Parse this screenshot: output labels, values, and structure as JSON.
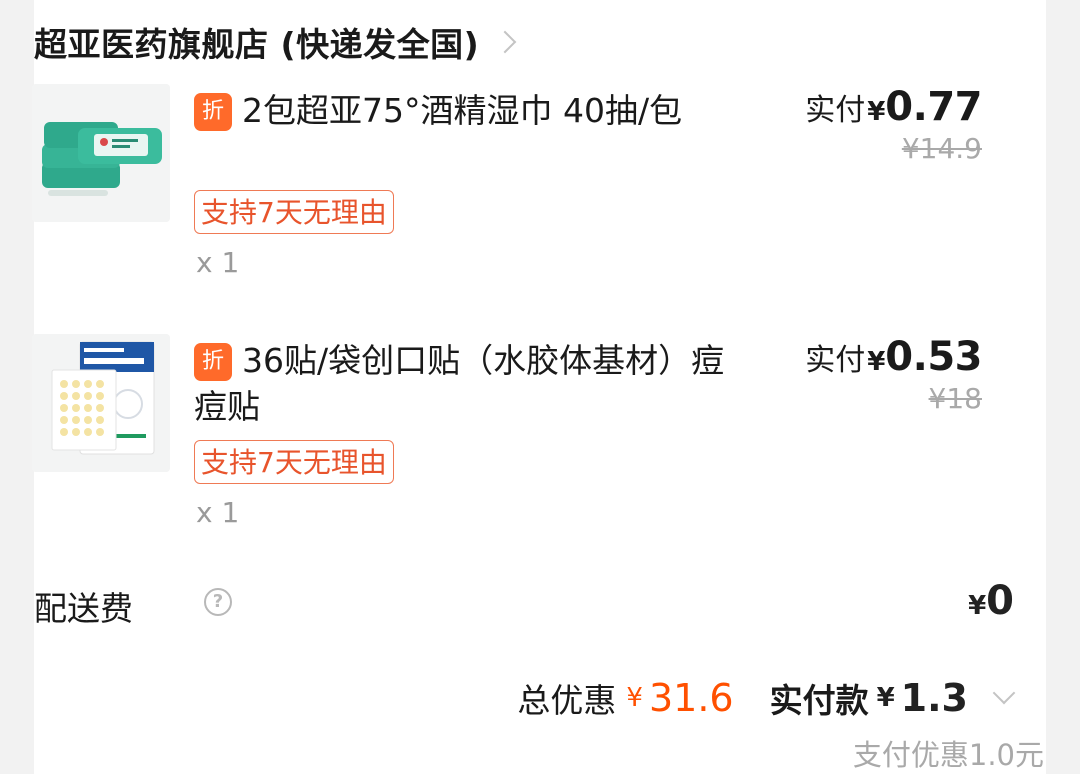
{
  "store": {
    "name": "超亚医药旗舰店 (快递发全国)",
    "chevron_icon": "chevron-right-icon"
  },
  "items": [
    {
      "badge": "折",
      "title": "2包超亚75°酒精湿巾 40抽/包",
      "paid_label": "实付",
      "paid_currency": "¥",
      "paid_amount": "0.77",
      "original_price": "¥14.9",
      "return_policy": "支持7天无理由",
      "quantity": "x 1",
      "thumbnail": "wet-wipes-product-image"
    },
    {
      "badge": "折",
      "title": "36贴/袋创口贴（水胶体基材）痘痘贴",
      "paid_label": "实付",
      "paid_currency": "¥",
      "paid_amount": "0.53",
      "original_price": "¥18",
      "return_policy": "支持7天无理由",
      "quantity": "x 1",
      "thumbnail": "acne-patch-product-image"
    }
  ],
  "shipping": {
    "label": "配送费",
    "help_icon": "question-icon",
    "help_glyph": "?",
    "currency": "¥",
    "amount": "0"
  },
  "summary": {
    "discount_label": "总优惠",
    "discount_currency": "¥",
    "discount_amount": "31.6",
    "total_label": "实付款",
    "total_currency": "¥",
    "total_amount": "1.3",
    "expand_icon": "chevron-down-icon",
    "pay_discount_note": "支付优惠1.0元"
  },
  "colors": {
    "accent": "#ff5000",
    "badge": "#ff6a2a",
    "tag_border": "#ef7a55",
    "muted": "#a9a9a9"
  }
}
